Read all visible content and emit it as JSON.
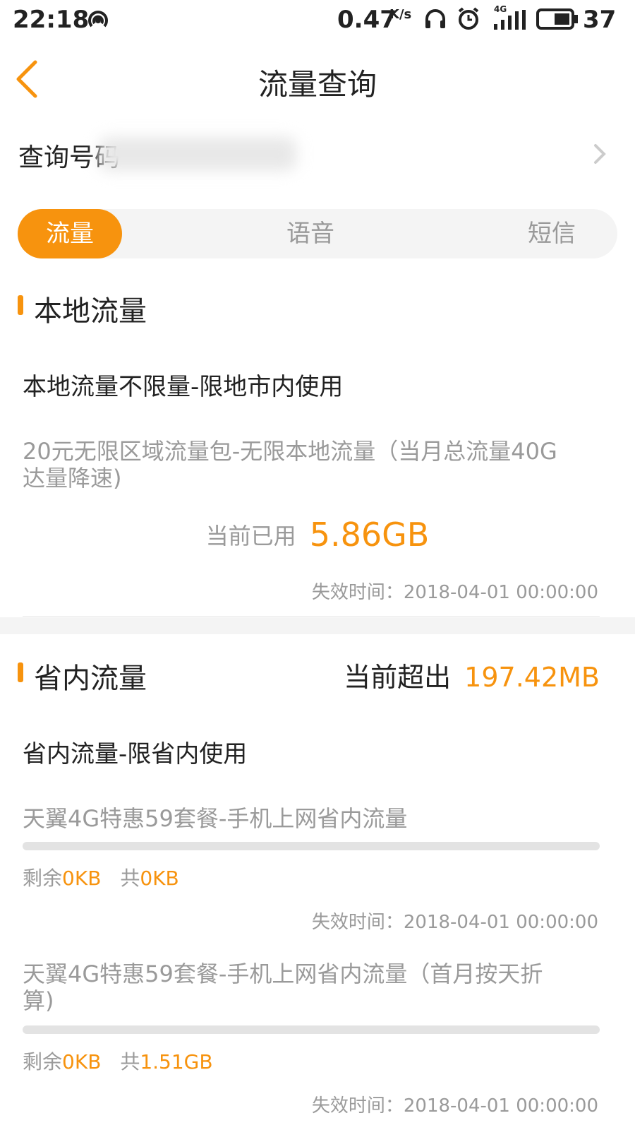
{
  "status_bar": {
    "time": "22:18",
    "speed": "0.47",
    "speed_unit": "K/s",
    "network": "4G",
    "battery": "37"
  },
  "header": {
    "title": "流量查询"
  },
  "query": {
    "label": "查询号码"
  },
  "tabs": [
    {
      "label": "流量",
      "active": true
    },
    {
      "label": "语音",
      "active": false
    },
    {
      "label": "短信",
      "active": false
    }
  ],
  "local": {
    "section_title": "本地流量",
    "item_title": "本地流量不限量-限地市内使用",
    "desc_line1": "20元无限区域流量包-无限本地流量（当月总流量40G",
    "desc_line2": "达量降速)",
    "used_label": "当前已用",
    "used_value": "5.86GB",
    "expire": "失效时间：2018-04-01 00:00:00"
  },
  "province": {
    "section_title": "省内流量",
    "over_label": "当前超出",
    "over_value": "197.42MB",
    "item_title": "省内流量-限省内使用",
    "packages": [
      {
        "name_line1": "天翼4G特惠59套餐-手机上网省内流量",
        "name_line2": "",
        "remain_label": "剩余",
        "remain_value": "0KB",
        "total_label": "共",
        "total_value": "0KB",
        "progress": 0,
        "expire": "失效时间：2018-04-01 00:00:00"
      },
      {
        "name_line1": "天翼4G特惠59套餐-手机上网省内流量（首月按天折",
        "name_line2": "算)",
        "remain_label": "剩余",
        "remain_value": "0KB",
        "total_label": "共",
        "total_value": "1.51GB",
        "progress": 0,
        "expire": "失效时间：2018-04-01 00:00:00"
      }
    ]
  },
  "colors": {
    "accent": "#f7930e",
    "muted_text": "#9a9a9a"
  }
}
